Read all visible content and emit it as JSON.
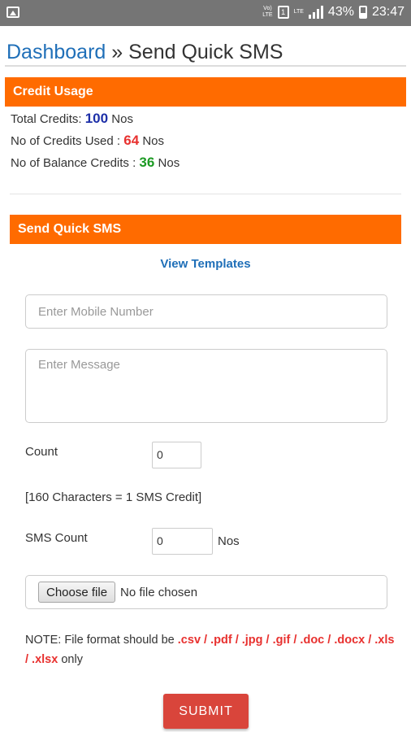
{
  "status_bar": {
    "network_label": "Vo)\nLTE",
    "sim_icon": "sim-card-icon",
    "lte_label": "LTE",
    "battery": "43%",
    "time": "23:47"
  },
  "breadcrumb": {
    "link": "Dashboard",
    "separator": "»",
    "current": "Send Quick SMS"
  },
  "credit_usage": {
    "title": "Credit Usage",
    "total_label": "Total Credits:",
    "total_value": "100",
    "used_label": "No of Credits Used :",
    "used_value": "64",
    "balance_label": "No of Balance Credits :",
    "balance_value": "36",
    "unit": "Nos"
  },
  "send_sms": {
    "title": "Send Quick SMS",
    "view_templates": "View Templates",
    "mobile_placeholder": "Enter Mobile Number",
    "message_placeholder": "Enter Message",
    "count_label": "Count",
    "count_value": "0",
    "credit_note": "[160 Characters = 1 SMS Credit]",
    "sms_count_label": "SMS Count",
    "sms_count_value": "0",
    "sms_count_unit": "Nos",
    "choose_file": "Choose file",
    "file_status": "No file chosen",
    "note_prefix": "NOTE: File format should be",
    "note_formats": ".csv / .pdf / .jpg / .gif / .doc / .docx / .xls / .xlsx",
    "note_suffix": "only",
    "submit": "SUBMIT"
  },
  "colors": {
    "header_orange": "#ff6b00",
    "link_blue": "#1f6fb8",
    "total_blue": "#1d2fa8",
    "used_red": "#e8312f",
    "balance_green": "#1c9a23",
    "submit_red": "#d9453b"
  }
}
